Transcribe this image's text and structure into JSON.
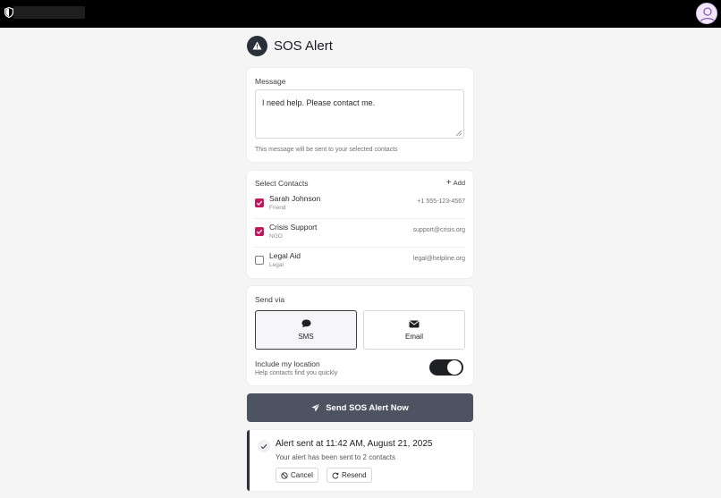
{
  "page": {
    "title": "SOS Alert"
  },
  "message": {
    "label": "Message",
    "value": "I need help. Please contact me.",
    "hint": "This message will be sent to your selected contacts"
  },
  "contacts": {
    "label": "Select Contacts",
    "add_label": "Add",
    "items": [
      {
        "name": "Sarah Johnson",
        "relation": "Friend",
        "address": "+1 555-123-4567",
        "checked": true
      },
      {
        "name": "Crisis Support",
        "relation": "NGO",
        "address": "support@crisis.org",
        "checked": true
      },
      {
        "name": "Legal Aid",
        "relation": "Legal",
        "address": "legal@helpline.org",
        "checked": false
      }
    ]
  },
  "send_via": {
    "label": "Send via",
    "options": [
      {
        "label": "SMS",
        "icon": "chat-bubble-icon",
        "selected": true
      },
      {
        "label": "Email",
        "icon": "envelope-icon",
        "selected": false
      }
    ],
    "location": {
      "label": "Include my location",
      "hint": "Help contacts find you quickly",
      "enabled": true
    }
  },
  "send_button": {
    "label": "Send SOS Alert Now",
    "icon": "paper-plane-icon"
  },
  "status": {
    "headline": "Alert sent at 11:42 AM, August 21, 2025",
    "detail": "Your alert has been sent to 2 contacts",
    "cancel_label": "Cancel",
    "resend_label": "Resend"
  },
  "colors": {
    "accent": "#c2185b",
    "dark": "#2a2f3a",
    "send_button": "#4d5360"
  }
}
